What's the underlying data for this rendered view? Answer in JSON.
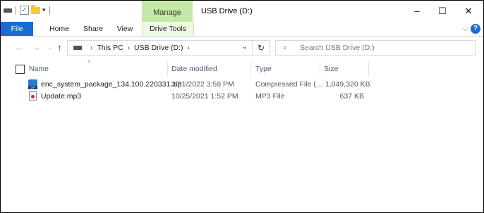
{
  "window": {
    "title": "USB Drive (D:)",
    "context_tab_group": "Manage",
    "controls": {
      "minimize": "–",
      "maximize": "☐",
      "close": "✕"
    }
  },
  "quick_access": {
    "dropdown": "▾"
  },
  "ribbon": {
    "tabs": [
      "File",
      "Home",
      "Share",
      "View",
      "Drive Tools"
    ],
    "expand": "⌵",
    "help": "?"
  },
  "nav": {
    "back": "←",
    "forward": "→",
    "recent": "⌄",
    "up": "↑"
  },
  "address": {
    "crumbs": [
      "This PC",
      "USB Drive (D:)"
    ],
    "separator": "›",
    "dropdown": "⌄",
    "refresh": "↻"
  },
  "search": {
    "placeholder": "Search USB Drive (D:)",
    "icon": "⌕"
  },
  "columns": {
    "sort_indicator": "^",
    "name": "Name",
    "date_modified": "Date modified",
    "type": "Type",
    "size": "Size"
  },
  "files": [
    {
      "name": "enc_system_package_134.100.220331.zip",
      "date": "3/31/2022 3:59 PM",
      "type": "Compressed File (...",
      "size": "1,049,320 KB",
      "icon": "zip-icon",
      "icon_tag": "ZIP"
    },
    {
      "name": "Update.mp3",
      "date": "10/25/2021 1:52 PM",
      "type": "MP3 File",
      "size": "637 KB",
      "icon": "mp3-icon"
    }
  ],
  "colors": {
    "accent": "#1a6dd0",
    "manage_tab": "#c6e8a6",
    "header_text": "#4a5a78"
  }
}
